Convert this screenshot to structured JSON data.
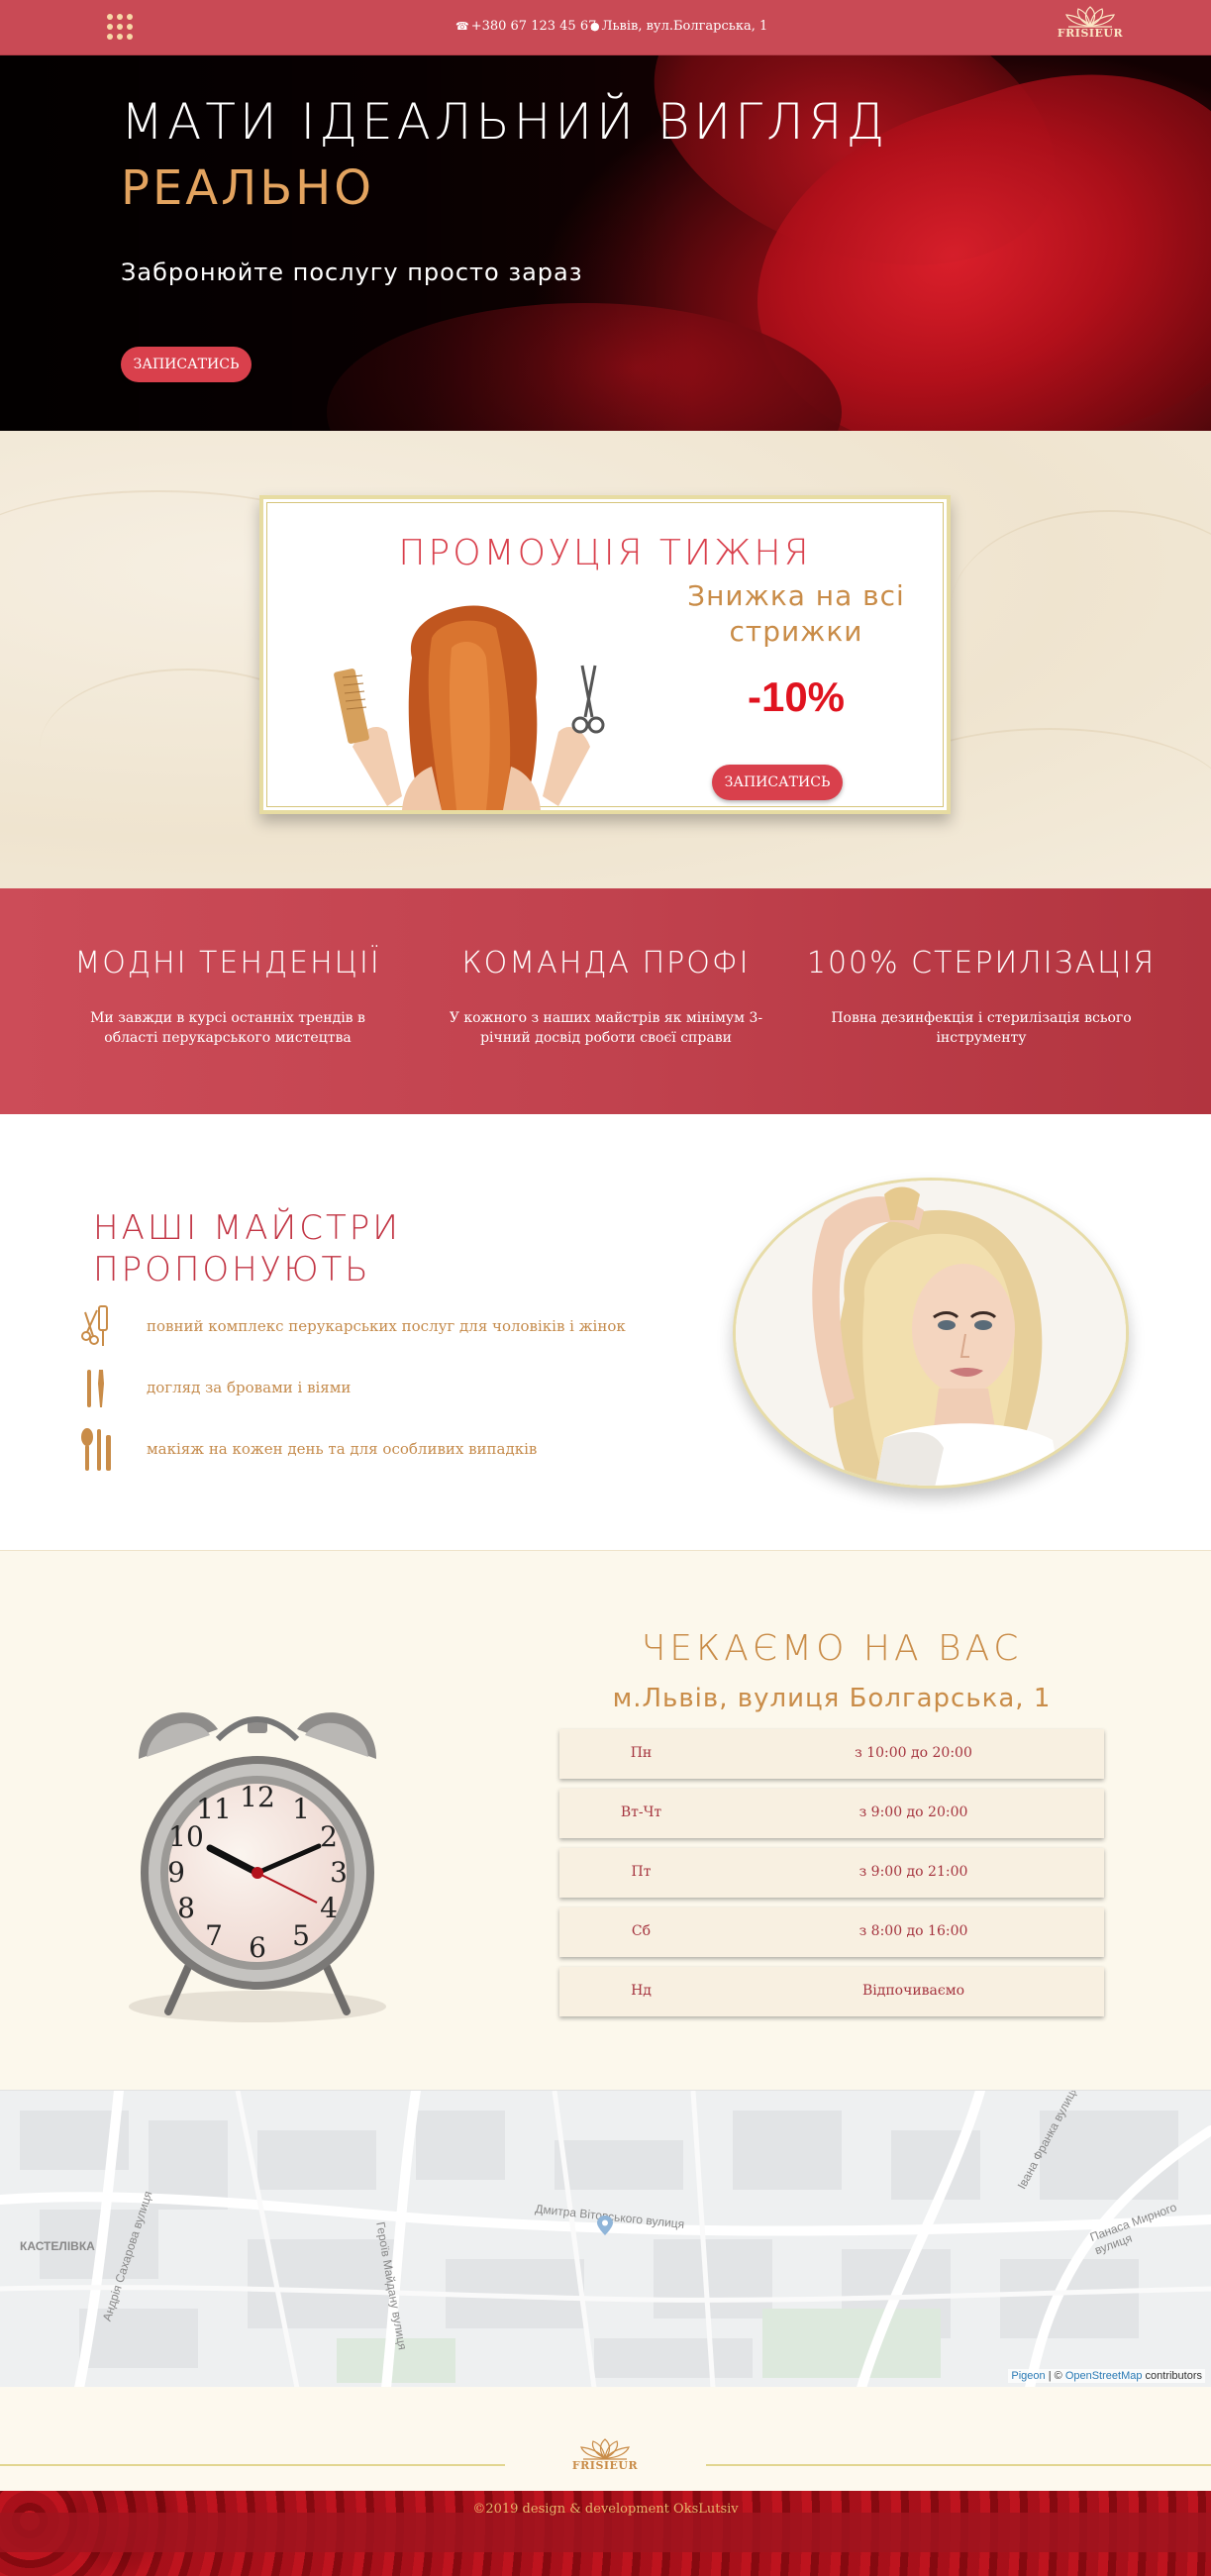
{
  "header": {
    "phone": "+380 67 123 45 67",
    "address": "Львів, вул.Болгарська, 1",
    "logo_text": "FRISIEUR"
  },
  "hero": {
    "title_line1": "МАТИ ІДЕАЛЬНИЙ ВИГЛЯД",
    "title_line2": "РЕАЛЬНО",
    "subtitle": "Забронюйте послугу просто зараз",
    "cta": "ЗАПИСАТИСЬ"
  },
  "promo": {
    "title": "ПРОМОУЦІЯ ТИЖНЯ",
    "discount_text": "Знижка на всі стрижки",
    "discount_value": "-10%",
    "cta": "ЗАПИСАТИСЬ"
  },
  "features": [
    {
      "title": "МОДНІ ТЕНДЕНЦІЇ",
      "text": "Ми завжди в курсі останніх трендів в області перукарського мистецтва"
    },
    {
      "title": "КОМАНДА ПРОФІ",
      "text": "У кожного з наших майстрів як мінімум 3-річний досвід роботи своєї справи"
    },
    {
      "title": "100% СТЕРИЛІЗАЦІЯ",
      "text": "Повна дезинфекція і стерилізація всього інструменту"
    }
  ],
  "masters": {
    "title_line1": "НАШІ МАЙСТРИ",
    "title_line2": "ПРОПОНУЮТЬ",
    "services": [
      {
        "icon": "comb-scissors-icon",
        "text": "повний комплекс перукарських послуг для чоловіків і жінок"
      },
      {
        "icon": "brow-tools-icon",
        "text": "догляд за бровами і віями"
      },
      {
        "icon": "makeup-brushes-icon",
        "text": "макіяж на кожен день та для особливих випадків"
      }
    ]
  },
  "hours": {
    "title": "ЧЕКАЄМО НА ВАС",
    "address": "м.Львів, вулиця Болгарська, 1",
    "schedule": [
      {
        "day": "Пн",
        "time": "з 10:00 до 20:00"
      },
      {
        "day": "Вт-Чт",
        "time": "з 9:00 до 20:00"
      },
      {
        "day": "Пт",
        "time": "з 9:00 до 21:00"
      },
      {
        "day": "Сб",
        "time": "з 8:00 до 16:00"
      },
      {
        "day": "Нд",
        "time": "Відпочиваємо"
      }
    ]
  },
  "map": {
    "labels": [
      "КАСТЕЛІВКА",
      "Дмитра Вітовського вулиця",
      "Героїв Майдану вулиця",
      "Андрія Сахарова вулиця",
      "Івана Франка вулиця",
      "Панаса Мирного вулиця"
    ],
    "attribution_pigeon": "Pigeon",
    "attribution_sep": " | © ",
    "attribution_osm": "OpenStreetMap",
    "attribution_tail": " contributors"
  },
  "footer": {
    "logo_text": "FRISIEUR",
    "copyright": "©2019 design & development OksLutsiv"
  },
  "colors": {
    "brand_red": "#c94a55",
    "accent_gold": "#c98c48",
    "promo_red": "#e0131f"
  }
}
